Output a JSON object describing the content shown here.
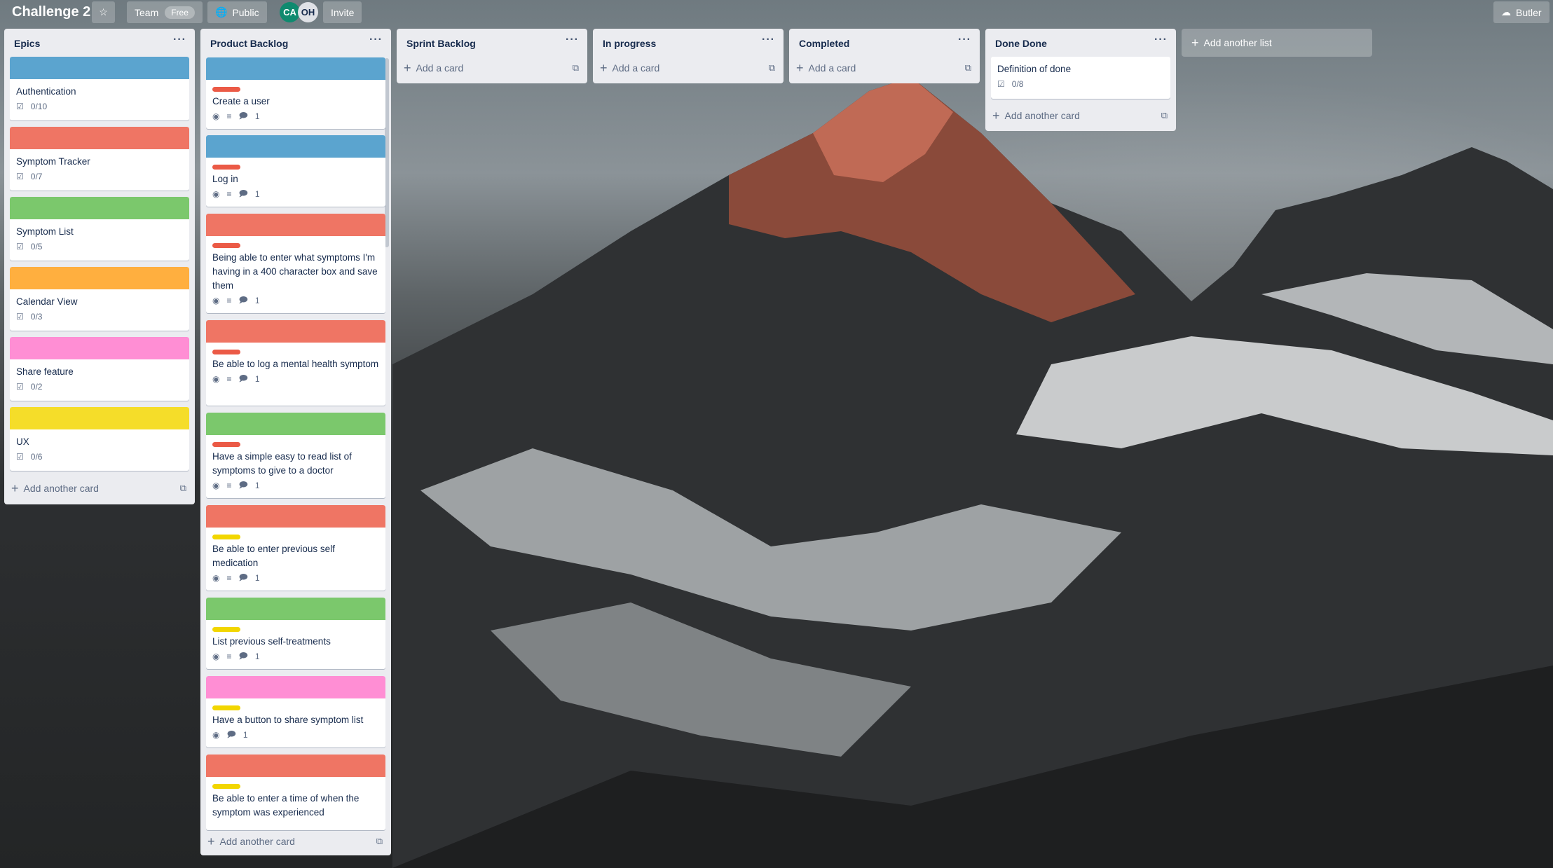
{
  "board": {
    "title": "Challenge 2",
    "team_label": "Team",
    "team_badge": "Free",
    "visibility": "Public",
    "invite_label": "Invite",
    "butler_label": "Butler",
    "members": [
      {
        "initials": "CA",
        "color": "#0f8a6f"
      },
      {
        "initials": "OH",
        "color": "#dfe1e6"
      }
    ]
  },
  "lists": {
    "epics": {
      "title": "Epics",
      "add_label": "Add another card",
      "cards": [
        {
          "title": "Authentication",
          "checklist": "0/10",
          "cover": "#5ba4cf"
        },
        {
          "title": "Symptom Tracker",
          "checklist": "0/7",
          "cover": "#ef7564"
        },
        {
          "title": "Symptom List",
          "checklist": "0/5",
          "cover": "#7bc86c"
        },
        {
          "title": "Calendar View",
          "checklist": "0/3",
          "cover": "#ffaf3f"
        },
        {
          "title": "Share feature",
          "checklist": "0/2",
          "cover": "#ff8ed4"
        },
        {
          "title": "UX",
          "checklist": "0/6",
          "cover": "#f5dd29"
        }
      ]
    },
    "backlog": {
      "title": "Product Backlog",
      "add_label": "Add another card",
      "cards": [
        {
          "title": "Create a user",
          "comments": "1",
          "cover": "#5ba4cf",
          "label": "#eb5a46"
        },
        {
          "title": "Log in",
          "comments": "1",
          "cover": "#5ba4cf",
          "label": "#eb5a46"
        },
        {
          "title": "Being able to enter what symptoms I'm having in a 400 character box and save them",
          "comments": "1",
          "cover": "#ef7564",
          "label": "#eb5a46"
        },
        {
          "title": "Be able to log a mental health symptom",
          "comments": "1",
          "cover": "#ef7564",
          "label": "#eb5a46"
        },
        {
          "title": "Have a simple easy to read list of symptoms to give to a doctor",
          "comments": "1",
          "cover": "#7bc86c",
          "label": "#eb5a46"
        },
        {
          "title": "Be able to enter previous self medication",
          "comments": "1",
          "cover": "#ef7564",
          "label": "#f2d600"
        },
        {
          "title": "List previous self-treatments",
          "comments": "1",
          "cover": "#7bc86c",
          "label": "#f2d600"
        },
        {
          "title": "Have a button to share symptom list",
          "comments": "1",
          "cover": "#ff8ed4",
          "label": "#f2d600"
        },
        {
          "title": "Be able to enter a time of when the symptom was experienced",
          "comments": "1",
          "cover": "#ef7564",
          "label": "#f2d600"
        }
      ]
    },
    "sprint": {
      "title": "Sprint Backlog",
      "add_label": "Add a card"
    },
    "progress": {
      "title": "In progress",
      "add_label": "Add a card"
    },
    "completed": {
      "title": "Completed",
      "add_label": "Add a card"
    },
    "done": {
      "title": "Done Done",
      "add_label": "Add another card",
      "cards": [
        {
          "title": "Definition of done",
          "checklist": "0/8"
        }
      ]
    },
    "add_list_label": "Add another list"
  },
  "icons": {
    "star": "star-icon",
    "globe": "globe-icon",
    "menu": "ellipsis-icon",
    "plus": "plus-icon",
    "template": "card-template-icon",
    "eye": "eye-icon",
    "description": "description-icon",
    "comment": "comment-icon",
    "checklist": "checklist-icon",
    "butler": "butler-icon"
  }
}
